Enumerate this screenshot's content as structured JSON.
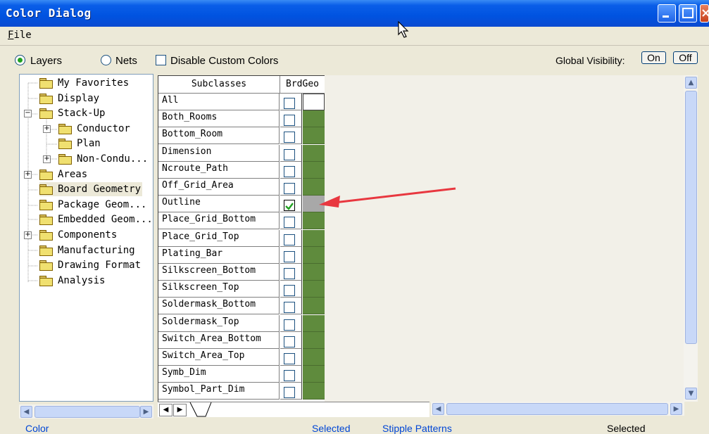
{
  "window": {
    "title": "Color Dialog"
  },
  "menu": {
    "file": "File"
  },
  "options": {
    "layers_label": "Layers",
    "nets_label": "Nets",
    "disable_custom_colors_label": "Disable Custom Colors",
    "global_visibility_label": "Global Visibility:",
    "on_label": "On",
    "off_label": "Off",
    "selected_mode": "Layers"
  },
  "tree": {
    "items": [
      {
        "label": "My Favorites",
        "level": 0,
        "expander": ""
      },
      {
        "label": "Display",
        "level": 0,
        "expander": ""
      },
      {
        "label": "Stack-Up",
        "level": 0,
        "expander": "−"
      },
      {
        "label": "Conductor",
        "level": 1,
        "expander": "+"
      },
      {
        "label": "Plan",
        "level": 1,
        "expander": ""
      },
      {
        "label": "Non-Condu...",
        "level": 1,
        "expander": "+"
      },
      {
        "label": "Areas",
        "level": 0,
        "expander": "+"
      },
      {
        "label": "Board Geometry",
        "level": 0,
        "expander": "",
        "selected": true
      },
      {
        "label": "Package Geom...",
        "level": 0,
        "expander": ""
      },
      {
        "label": "Embedded Geom...",
        "level": 0,
        "expander": ""
      },
      {
        "label": "Components",
        "level": 0,
        "expander": "+"
      },
      {
        "label": "Manufacturing",
        "level": 0,
        "expander": ""
      },
      {
        "label": "Drawing Format",
        "level": 0,
        "expander": ""
      },
      {
        "label": "Analysis",
        "level": 0,
        "expander": ""
      }
    ]
  },
  "grid": {
    "header_subclasses": "Subclasses",
    "header_column": "BrdGeo",
    "rows": [
      {
        "name": "All",
        "checked": false,
        "color": "none"
      },
      {
        "name": "Both_Rooms",
        "checked": false,
        "color": "#5f8b3d"
      },
      {
        "name": "Bottom_Room",
        "checked": false,
        "color": "#5f8b3d"
      },
      {
        "name": "Dimension",
        "checked": false,
        "color": "#5f8b3d"
      },
      {
        "name": "Ncroute_Path",
        "checked": false,
        "color": "#5f8b3d"
      },
      {
        "name": "Off_Grid_Area",
        "checked": false,
        "color": "#5f8b3d"
      },
      {
        "name": "Outline",
        "checked": true,
        "color": "#a8a8a8"
      },
      {
        "name": "Place_Grid_Bottom",
        "checked": false,
        "color": "#5f8b3d"
      },
      {
        "name": "Place_Grid_Top",
        "checked": false,
        "color": "#5f8b3d"
      },
      {
        "name": "Plating_Bar",
        "checked": false,
        "color": "#5f8b3d"
      },
      {
        "name": "Silkscreen_Bottom",
        "checked": false,
        "color": "#5f8b3d"
      },
      {
        "name": "Silkscreen_Top",
        "checked": false,
        "color": "#5f8b3d"
      },
      {
        "name": "Soldermask_Bottom",
        "checked": false,
        "color": "#5f8b3d"
      },
      {
        "name": "Soldermask_Top",
        "checked": false,
        "color": "#5f8b3d"
      },
      {
        "name": "Switch_Area_Bottom",
        "checked": false,
        "color": "#5f8b3d"
      },
      {
        "name": "Switch_Area_Top",
        "checked": false,
        "color": "#5f8b3d"
      },
      {
        "name": "Symb_Dim",
        "checked": false,
        "color": "#5f8b3d"
      },
      {
        "name": "Symbol_Part_Dim",
        "checked": false,
        "color": "#5f8b3d"
      }
    ]
  },
  "bottom": {
    "color_label": "Color",
    "selected_label": "Selected",
    "stipple_label": "Stipple Patterns",
    "selected_right_label": "Selected"
  },
  "colors": {
    "title_bar": "#0053e0",
    "accent_arrow": "#e8373f",
    "layer_color": "#5f8b3d"
  }
}
